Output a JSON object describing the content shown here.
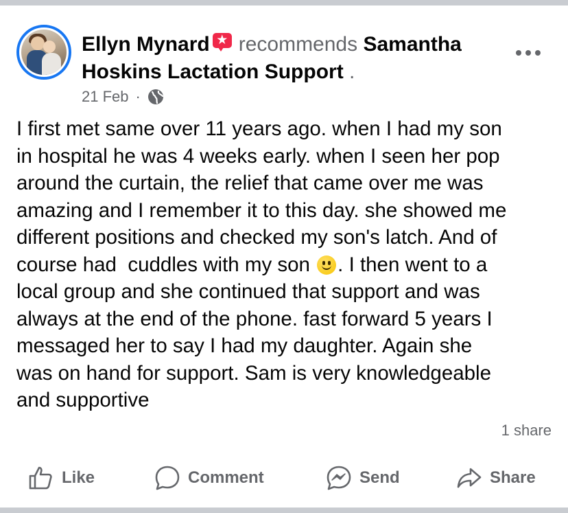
{
  "post": {
    "author": "Ellyn Mynard",
    "recommends_text": "recommends",
    "page_name_line1": "Samantha",
    "page_name_line2": "Hoskins Lactation Support",
    "trailing_dot": ".",
    "date": "21 Feb",
    "separator": "·",
    "body_part1": "I first met same over 11 years ago. when I had my son\nin hospital he was 4 weeks early. when I seen her pop\naround the curtain, the relief that came over me was\namazing and I remember it to this day. she showed me\ndifferent positions and checked my son's latch. And of\ncourse had  cuddles with my son ",
    "body_part2": ". I then went to a\nlocal group and she continued that support and was\nalways at the end of the phone. fast forward 5 years I\nmessaged her to say I had my daughter. Again she\nwas on hand for support. Sam is very knowledgeable\nand supportive",
    "shares": "1 share"
  },
  "actions": {
    "like": "Like",
    "comment": "Comment",
    "send": "Send",
    "share": "Share"
  },
  "icons": {
    "recommend": "recommend-star-icon",
    "globe": "globe-icon",
    "more": "more-options-icon",
    "smiley": "smiley-emoji-icon"
  },
  "colors": {
    "accent": "#1877f2",
    "recommend": "#f02849",
    "secondary_text": "#65676b"
  }
}
